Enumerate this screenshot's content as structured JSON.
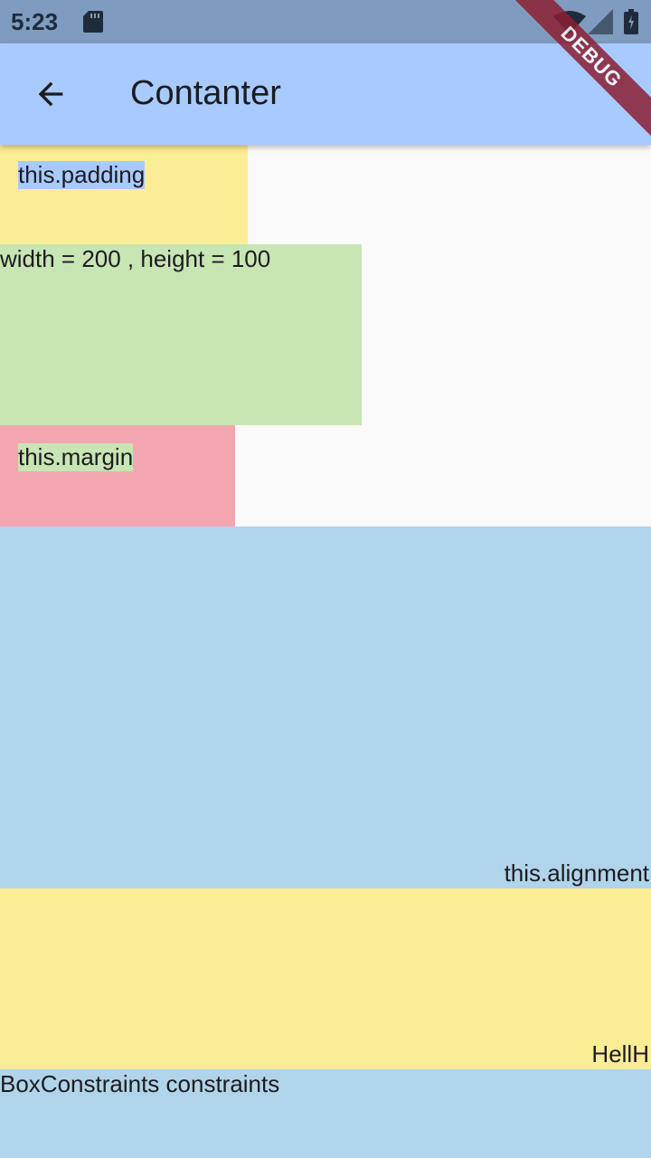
{
  "status_bar": {
    "time": "5:23",
    "icons": [
      "sd-card-icon",
      "wifi-icon",
      "signal-icon",
      "battery-icon"
    ]
  },
  "app_bar": {
    "back_icon": "arrow-back-icon",
    "title": "Contanter"
  },
  "debug_banner": {
    "label": "DEBUG"
  },
  "demo": {
    "padding_label": "this.padding",
    "size_label": "width = 200 , height = 100",
    "margin_label": "this.margin",
    "alignment_label": "this.alignment",
    "yellow_label": "HellH",
    "constraints_label": "BoxConstraints constraints"
  },
  "colors": {
    "status_bar": "#7f9bc0",
    "app_bar": "#a8caff",
    "yellow": "#fbec96",
    "green": "#c8e5b4",
    "pink": "#f4a6b0",
    "blue": "#b0d4ea",
    "debug": "#8b1f33"
  }
}
